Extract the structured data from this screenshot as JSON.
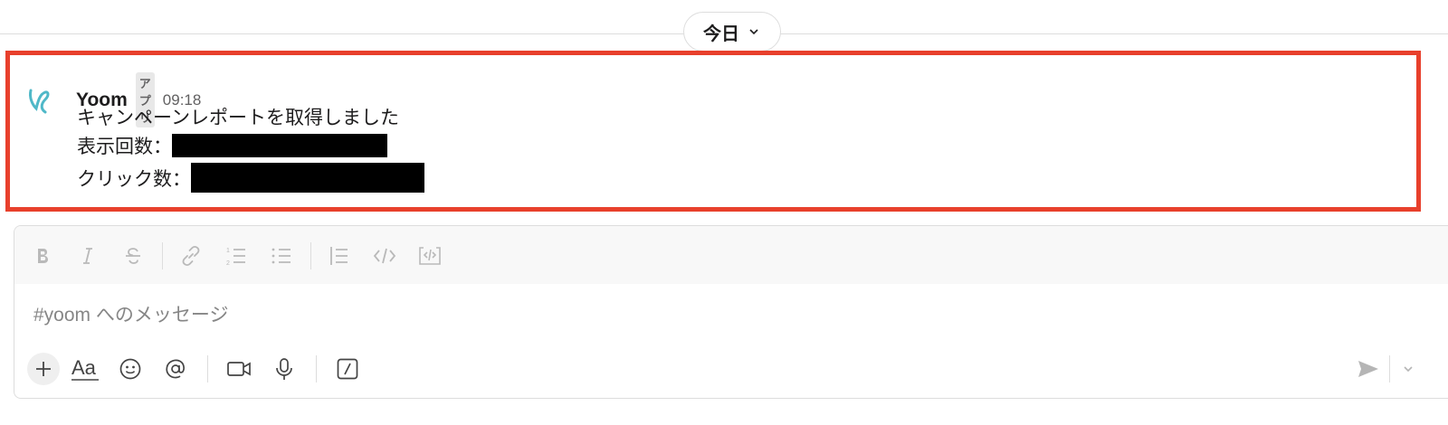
{
  "date_divider": {
    "label": "今日"
  },
  "message": {
    "sender": "Yoom",
    "badge": "アプリ",
    "time": "09:18",
    "lines": {
      "title": "キャンペーンレポートを取得しました",
      "impressions_label": "表示回数：",
      "clicks_label": "クリック数："
    }
  },
  "composer": {
    "placeholder": "#yoom へのメッセージ",
    "format_icons": [
      "bold-icon",
      "italic-icon",
      "strikethrough-icon",
      "link-icon",
      "ordered-list-icon",
      "bullet-list-icon",
      "blockquote-icon",
      "code-icon",
      "code-block-icon"
    ],
    "bottom_icons": [
      "plus-icon",
      "text-format-icon",
      "emoji-icon",
      "mention-icon",
      "video-icon",
      "microphone-icon",
      "slash-command-icon",
      "send-icon"
    ],
    "text_format_glyph": "Aa"
  },
  "colors": {
    "highlight": "#e8402c",
    "logo": "#4fb8c8"
  }
}
